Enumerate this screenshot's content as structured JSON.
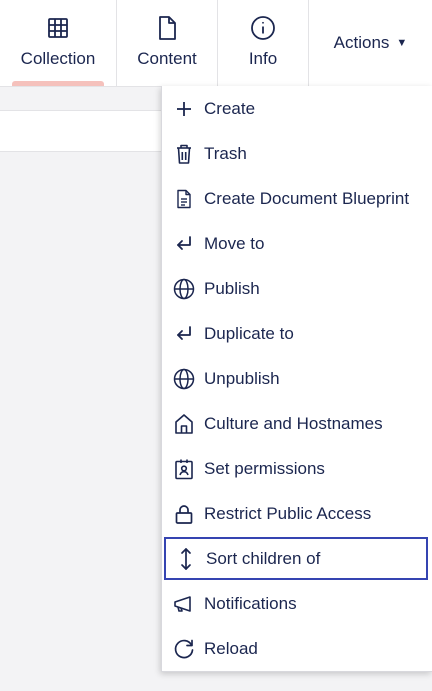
{
  "tabs": [
    {
      "label": "Collection",
      "icon": "grid-icon",
      "active": true
    },
    {
      "label": "Content",
      "icon": "document-icon",
      "active": false
    },
    {
      "label": "Info",
      "icon": "info-icon",
      "active": false
    }
  ],
  "actions_label": "Actions",
  "menu": {
    "items": [
      {
        "label": "Create",
        "icon": "plus-icon"
      },
      {
        "label": "Trash",
        "icon": "trash-icon"
      },
      {
        "label": "Create Document Blueprint",
        "icon": "blueprint-icon"
      },
      {
        "label": "Move to",
        "icon": "move-arrow-icon"
      },
      {
        "label": "Publish",
        "icon": "globe-icon"
      },
      {
        "label": "Duplicate to",
        "icon": "duplicate-arrow-icon"
      },
      {
        "label": "Unpublish",
        "icon": "globe-icon"
      },
      {
        "label": "Culture and Hostnames",
        "icon": "home-icon"
      },
      {
        "label": "Set permissions",
        "icon": "permissions-badge-icon"
      },
      {
        "label": "Restrict Public Access",
        "icon": "lock-icon"
      },
      {
        "label": "Sort children of",
        "icon": "vertical-arrows-icon",
        "focused": true
      },
      {
        "label": "Notifications",
        "icon": "megaphone-icon"
      },
      {
        "label": "Reload",
        "icon": "reload-icon"
      }
    ]
  },
  "colors": {
    "text": "#1b264f",
    "active_tab_indicator": "#f5c1bc",
    "focus_outline": "#3544b1",
    "background": "#f3f3f5"
  }
}
